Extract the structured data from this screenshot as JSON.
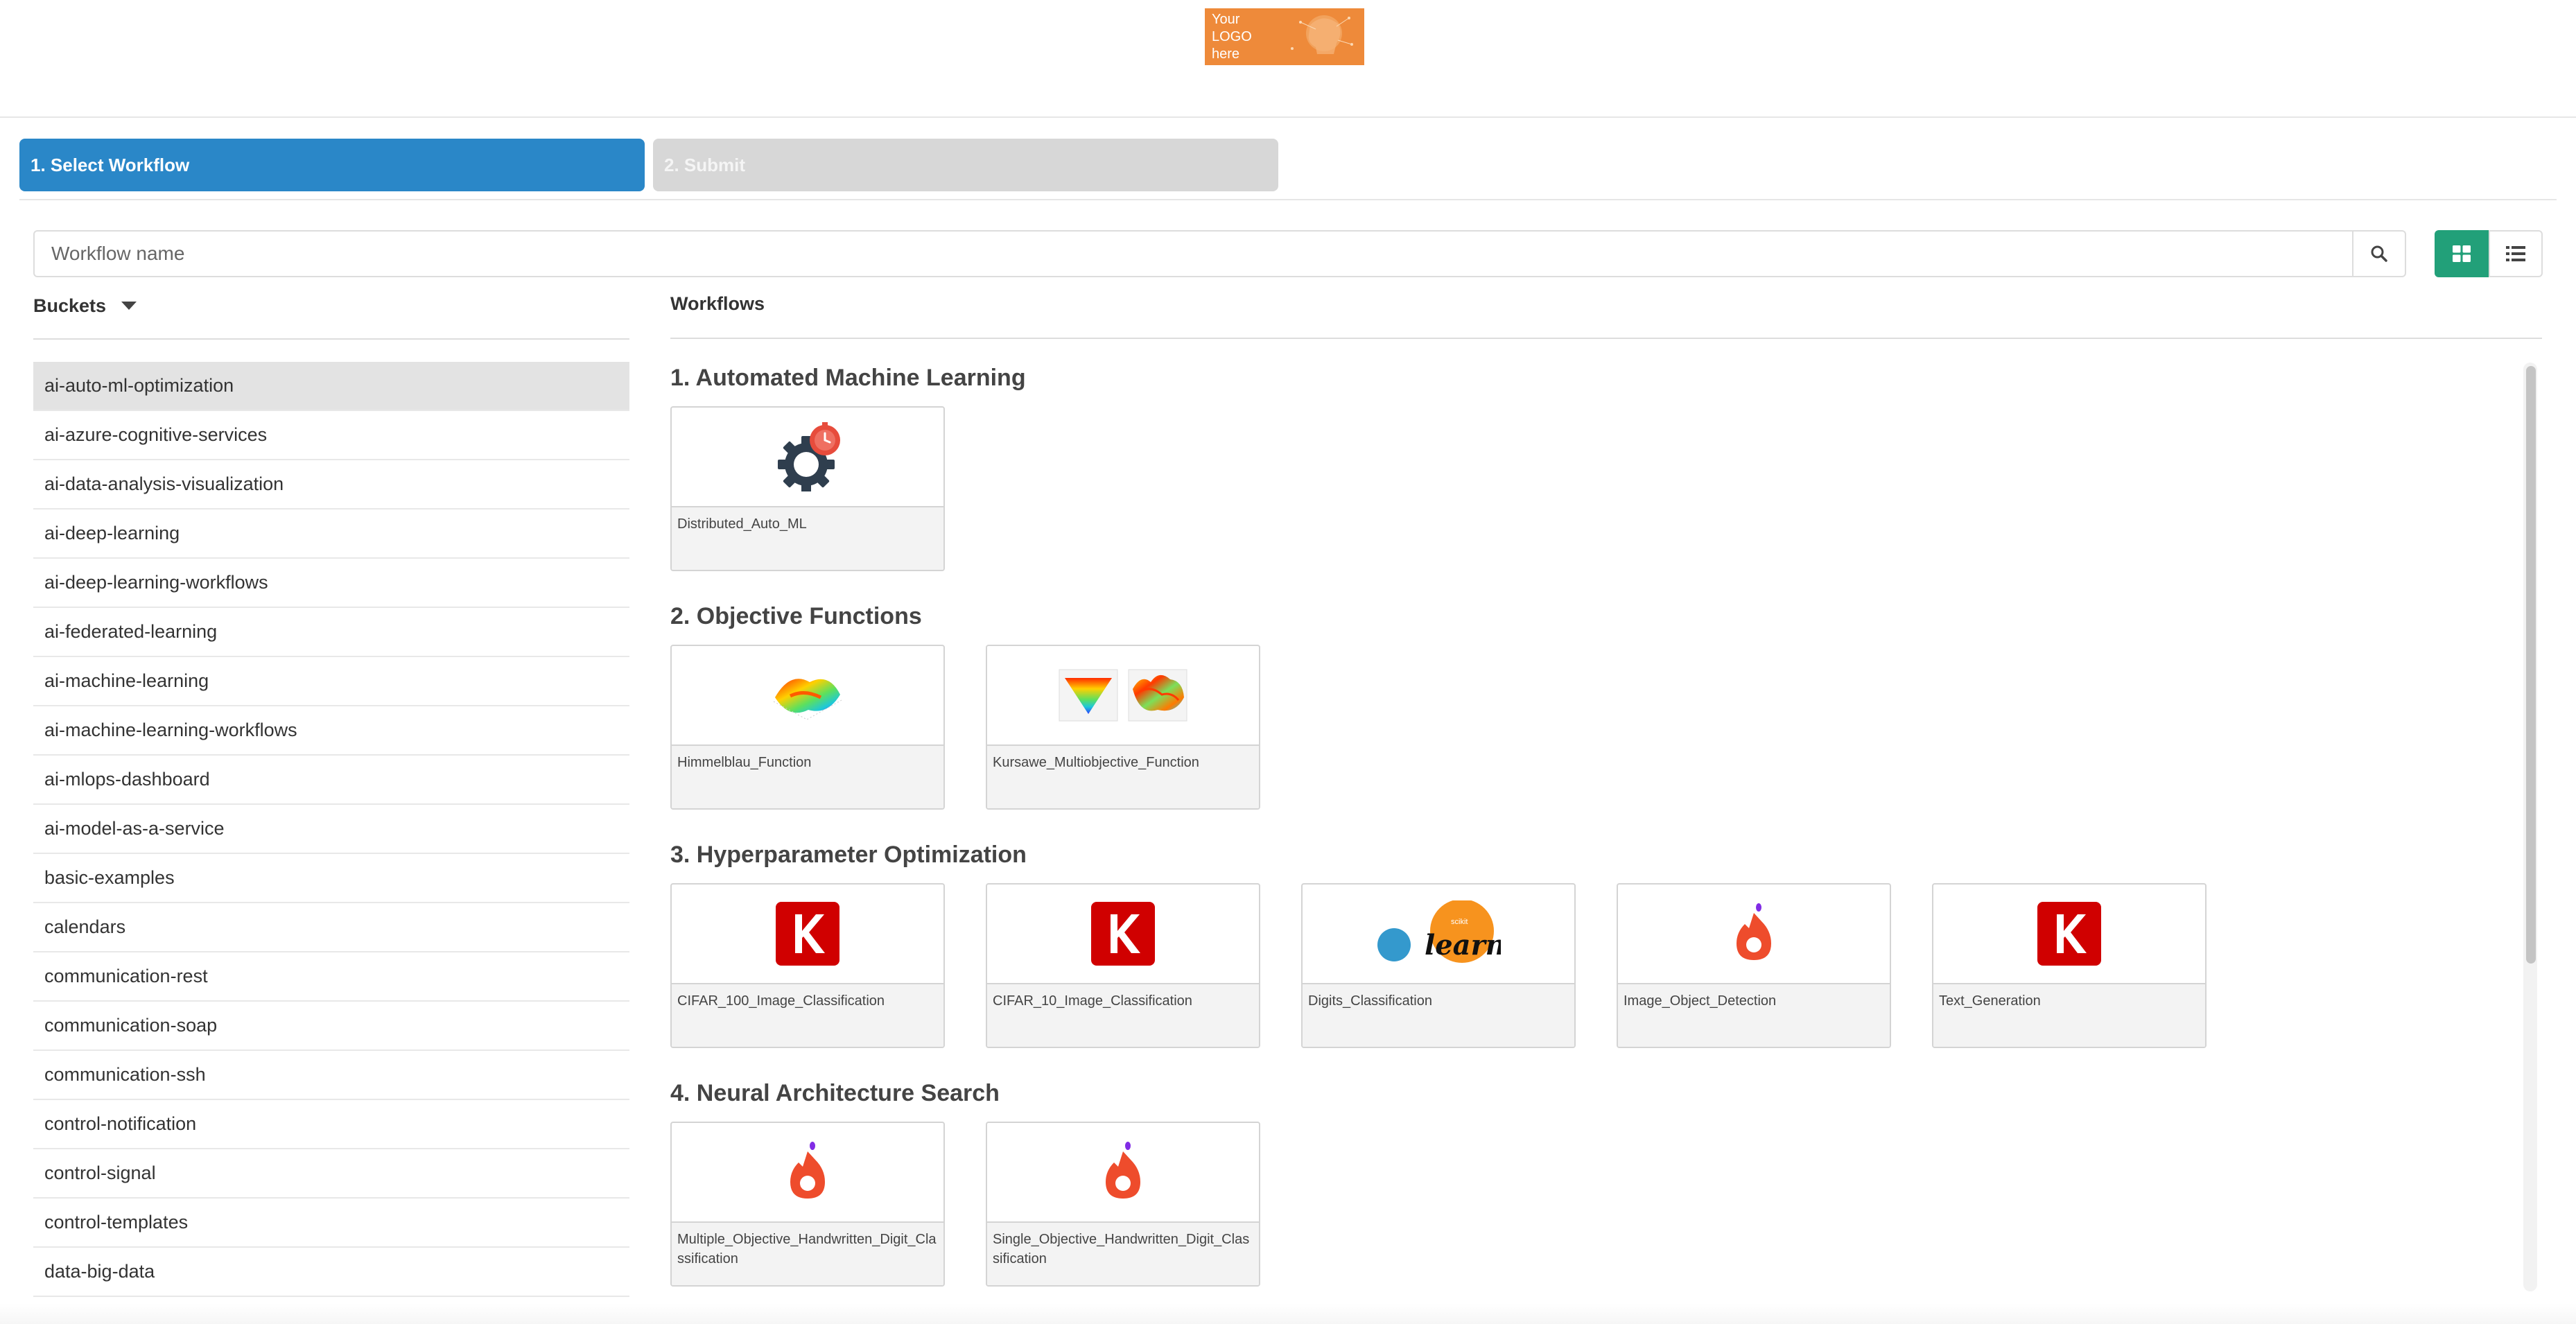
{
  "logo": {
    "text": "Your LOGO here"
  },
  "steps": [
    {
      "label": "1. Select Workflow",
      "active": true
    },
    {
      "label": "2. Submit",
      "active": false
    }
  ],
  "search": {
    "placeholder": "Workflow name",
    "value": ""
  },
  "view_modes": {
    "selected": "grid"
  },
  "buckets": {
    "title": "Buckets",
    "items": [
      "ai-auto-ml-optimization",
      "ai-azure-cognitive-services",
      "ai-data-analysis-visualization",
      "ai-deep-learning",
      "ai-deep-learning-workflows",
      "ai-federated-learning",
      "ai-machine-learning",
      "ai-machine-learning-workflows",
      "ai-mlops-dashboard",
      "ai-model-as-a-service",
      "basic-examples",
      "calendars",
      "communication-rest",
      "communication-soap",
      "communication-ssh",
      "control-notification",
      "control-signal",
      "control-templates",
      "data-big-data"
    ],
    "selected": "ai-auto-ml-optimization"
  },
  "workflows": {
    "title": "Workflows",
    "groups": [
      {
        "title": "1. Automated Machine Learning",
        "items": [
          {
            "name": "Distributed_Auto_ML",
            "icon": "gear-timer-icon"
          }
        ]
      },
      {
        "title": "2. Objective Functions",
        "items": [
          {
            "name": "Himmelblau_Function",
            "icon": "surface-plot-icon"
          },
          {
            "name": "Kursawe_Multiobjective_Function",
            "icon": "surface-plots-icon"
          }
        ]
      },
      {
        "title": "3. Hyperparameter Optimization",
        "items": [
          {
            "name": "CIFAR_100_Image_Classification",
            "icon": "keras-icon"
          },
          {
            "name": "CIFAR_10_Image_Classification",
            "icon": "keras-icon"
          },
          {
            "name": "Digits_Classification",
            "icon": "scikit-learn-icon",
            "logo_text": "learn",
            "logo_small_text": "scikit"
          },
          {
            "name": "Image_Object_Detection",
            "icon": "flame-icon"
          },
          {
            "name": "Text_Generation",
            "icon": "keras-icon"
          }
        ]
      },
      {
        "title": "4. Neural Architecture Search",
        "items": [
          {
            "name": "Multiple_Objective_Handwritten_Digit_Classification",
            "icon": "flame-icon"
          },
          {
            "name": "Single_Objective_Handwritten_Digit_Classification",
            "icon": "flame-icon"
          }
        ]
      }
    ]
  },
  "colors": {
    "step_active": "#2a87c8",
    "step_inactive": "#d7d7d7",
    "view_active": "#22a079",
    "keras_red": "#d00000",
    "flame": "#ee4c2c",
    "logo_bg": "#ee8a3a"
  }
}
